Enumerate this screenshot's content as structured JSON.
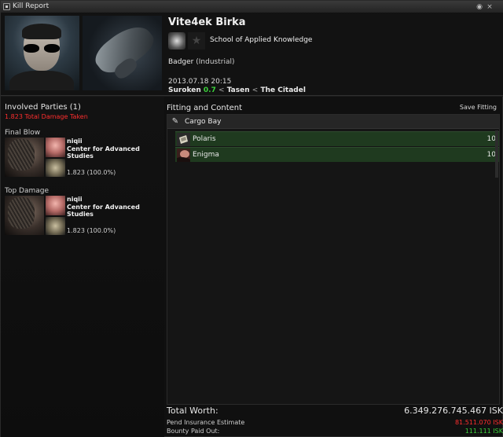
{
  "window": {
    "title": "Kill Report",
    "icon": "kill-report-icon",
    "buttons": [
      "settings-icon",
      "close-icon"
    ]
  },
  "victim": {
    "name": "Vite4ek Birka",
    "corporation": "School of Applied Knowledge",
    "ship": "Badger",
    "ship_class": "(Industrial)",
    "datetime": "2013.07.18 20:15",
    "location": {
      "system": "Suroken",
      "security": "0.7",
      "constellation": "Tasen",
      "region": "The Citadel",
      "separator": "<"
    }
  },
  "involved": {
    "title": "Involved Parties (1)",
    "total_damage": "1.823 Total Damage Taken",
    "final_blow_label": "Final Blow",
    "top_damage_label": "Top Damage",
    "final_blow": {
      "name": "niqii",
      "corp": "Center for Advanced Studies",
      "damage": "1.823 (100.0%)"
    },
    "top_damage": {
      "name": "niqii",
      "corp": "Center for Advanced Studies",
      "damage": "1.823 (100.0%)"
    }
  },
  "fitting": {
    "title": "Fitting and Content",
    "save_label": "Save Fitting",
    "cargo_label": "Cargo Bay",
    "items": [
      {
        "name": "Polaris",
        "qty": "10",
        "icon": "polaris-item-icon"
      },
      {
        "name": "Enigma",
        "qty": "10",
        "icon": "enigma-item-icon"
      }
    ]
  },
  "summary": {
    "total_worth_label": "Total Worth:",
    "total_worth_value": "6.349.276.745.467 ISK",
    "insurance_label": "Pend Insurance Estimate",
    "insurance_value": "81.511.070 ISK",
    "bounty_label": "Bounty Paid Out:",
    "bounty_value": "111.111 ISK"
  },
  "colors": {
    "security_green": "#3bd13b",
    "damage_red": "#ff2e2e",
    "insurance_red": "#ff2e2e",
    "bounty_green": "#3bd13b",
    "item_row_bg": "#1f3a1f"
  }
}
